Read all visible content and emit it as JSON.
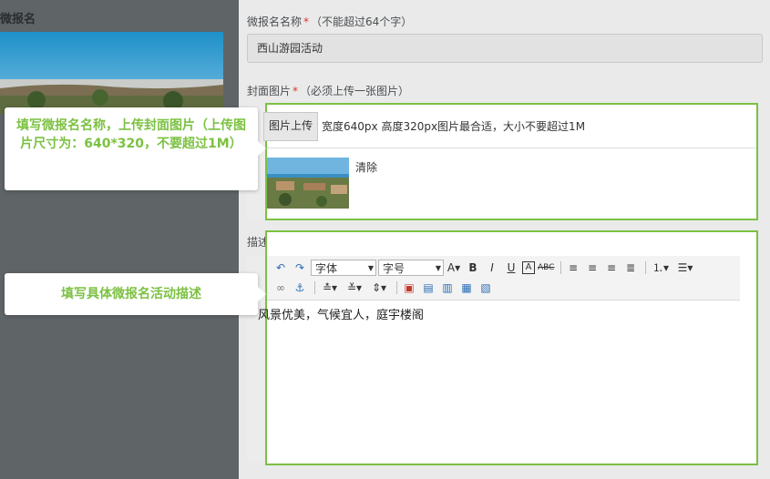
{
  "left": {
    "title": "微报名"
  },
  "form": {
    "name_label": "微报名名称",
    "name_hint": "（不能超过64个字）",
    "name_value": "西山游园活动",
    "cover_label": "封面图片",
    "cover_hint": "（必须上传一张图片）",
    "upload_button": "图片上传",
    "upload_hint": "宽度640px 高度320px图片最合适，大小不要超过1M",
    "clear_label": "清除",
    "desc_label": "描述",
    "required_mark": "*"
  },
  "editor": {
    "font_family_select": "字体",
    "font_size_select": "字号",
    "content": "风景优美，气候宜人，庭宇楼阁",
    "toolbar_row1": [
      "undo-icon",
      "redo-icon",
      "font-color-icon",
      "bold-icon",
      "italic-icon",
      "underline-icon",
      "border-icon",
      "strikethrough-icon",
      "align-left-icon",
      "align-center-icon",
      "align-right-icon",
      "justify-icon",
      "ordered-list-icon",
      "unordered-list-icon"
    ],
    "toolbar_row2": [
      "link-icon",
      "anchor-icon",
      "indent-icon",
      "paragraph-icon",
      "line-height-icon",
      "image-icon",
      "image-left-icon",
      "image-right-icon",
      "image-center-icon",
      "image-block-icon"
    ]
  },
  "callouts": {
    "cover": "填写微报名名称，上传封面图片（上传图片尺寸为：640*320，不要超过1M）",
    "description": "填写具体微报名活动描述"
  },
  "colors": {
    "accent": "#7cc142",
    "required": "#d9342b"
  }
}
